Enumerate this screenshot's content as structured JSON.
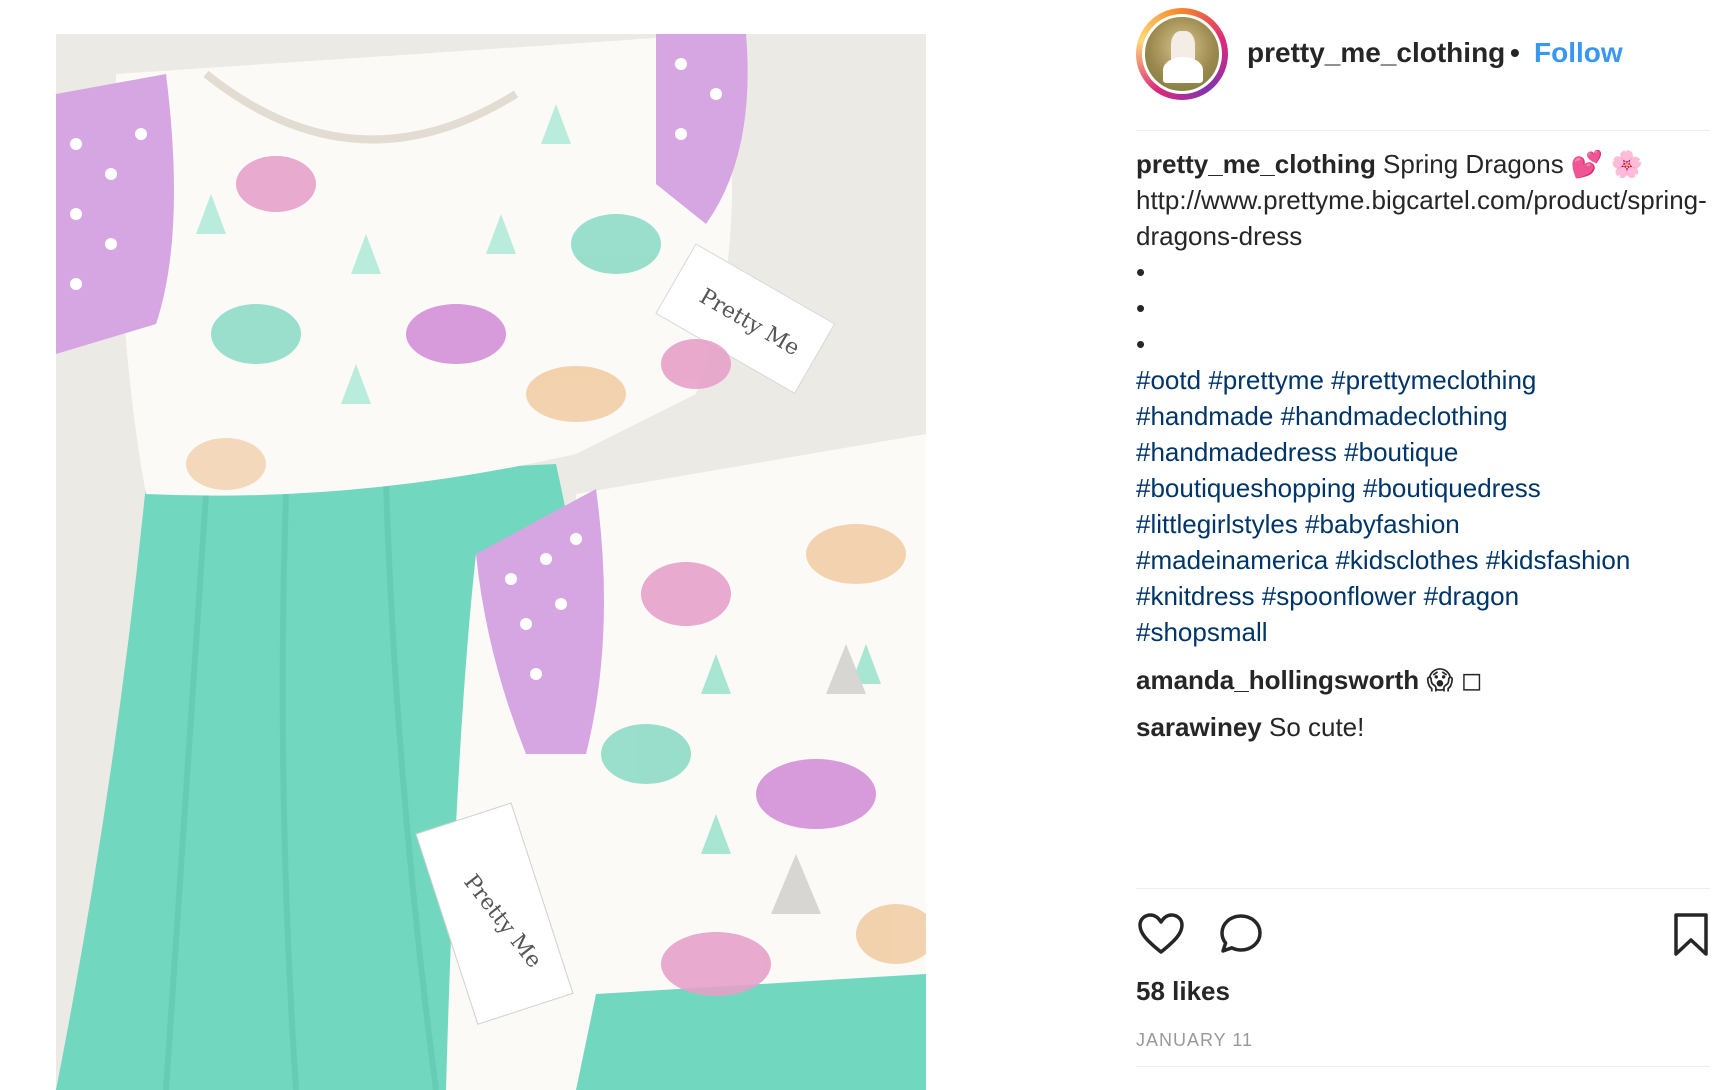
{
  "post": {
    "username": "pretty_me_clothing",
    "separator": "•",
    "follow_label": "Follow",
    "avatar_icon": "profile-avatar",
    "image_description_icon": "photo-dragon-dresses"
  },
  "caption": {
    "username": "pretty_me_clothing",
    "text": " Spring Dragons 💕 🌸",
    "link": "http://www.prettyme.bigcartel.com/product/spring-dragons-dress",
    "bullets": [
      "•",
      "•",
      "•"
    ],
    "hashtags": [
      "#ootd",
      "#prettyme",
      "#prettymeclothing",
      "#handmade",
      "#handmadeclothing",
      "#handmadedress",
      "#boutique",
      "#boutiqueshopping",
      "#boutiquedress",
      "#littlegirlstyles",
      "#babyfashion",
      "#madeinamerica",
      "#kidsclothes",
      "#kidsfashion",
      "#knitdress",
      "#spoonflower",
      "#dragon",
      "#shopsmall"
    ]
  },
  "comments": [
    {
      "username": "amanda_hollingsworth",
      "text": " 😱 ◻"
    },
    {
      "username": "sarawiney",
      "text": " So cute!"
    }
  ],
  "actions": {
    "like_icon": "heart-icon",
    "comment_icon": "comment-icon",
    "save_icon": "bookmark-icon"
  },
  "likes_text": "58 likes",
  "date_text": "JANUARY 11",
  "colors": {
    "link_blue": "#3897f0",
    "hashtag_blue": "#003569",
    "text": "#262626",
    "muted": "#999999",
    "divider": "#efefef",
    "mint": "#6fd8bf",
    "lavender": "#d9a9e6"
  }
}
